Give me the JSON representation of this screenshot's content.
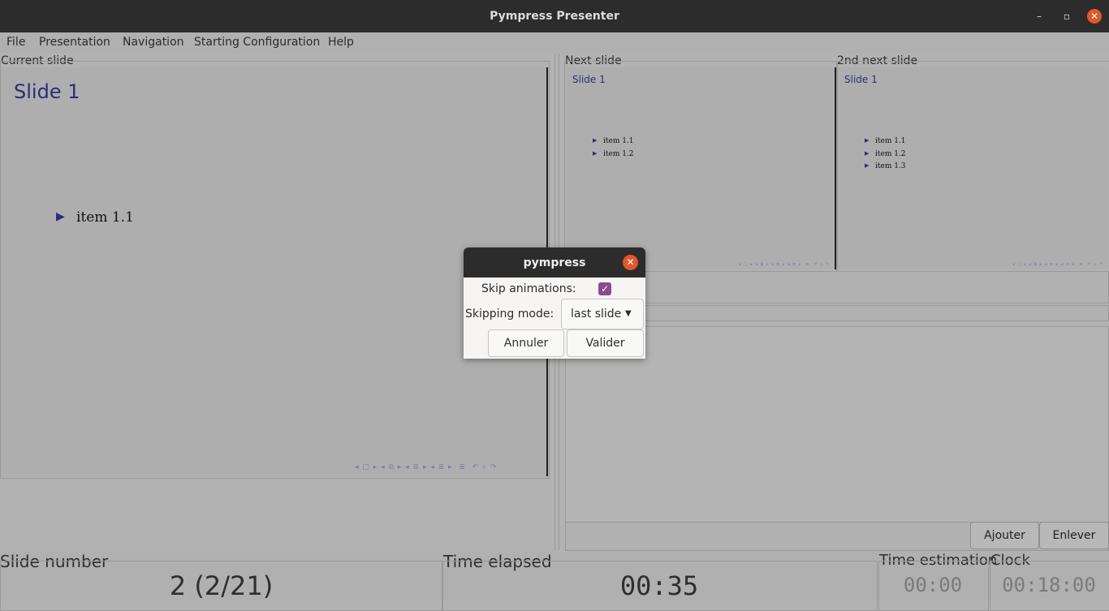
{
  "window": {
    "title": "Pympress Presenter",
    "minimize_icon": "minimize-icon",
    "maximize_icon": "maximize-icon",
    "close_icon": "close-icon"
  },
  "menu": {
    "items": [
      "File",
      "Presentation",
      "Navigation",
      "Starting Configuration",
      "Help"
    ]
  },
  "current": {
    "label": "Current slide",
    "slide_title": "Slide 1",
    "items": [
      "item 1.1"
    ]
  },
  "next": {
    "label": "Next slide",
    "slide_title": "Slide 1",
    "items": [
      "item 1.1",
      "item 1.2"
    ]
  },
  "next2": {
    "label": "2nd next slide",
    "slide_title": "Slide 1",
    "items": [
      "item 1.1",
      "item 1.2",
      "item 1.3"
    ]
  },
  "annotations": {
    "add_label": "Ajouter",
    "remove_label": "Enlever"
  },
  "bottom": {
    "slide_number_label": "Slide number",
    "slide_number_value": "2 (2/21)",
    "time_elapsed_label": "Time elapsed",
    "time_elapsed_value": "00:35",
    "time_estimation_label": "Time estimation",
    "time_estimation_value": "00:00",
    "clock_label": "Clock",
    "clock_value": "00:18:00"
  },
  "dialog": {
    "title": "pympress",
    "skip_animations_label": "Skip animations:",
    "skip_animations_checked": true,
    "skipping_mode_label": "Skipping mode:",
    "skipping_mode_value": "last slide",
    "cancel_label": "Annuler",
    "ok_label": "Valider"
  },
  "colors": {
    "accent_checkbox": "#8a4c8f",
    "close_button": "#e1582b",
    "slide_title": "#2d2d7a"
  }
}
